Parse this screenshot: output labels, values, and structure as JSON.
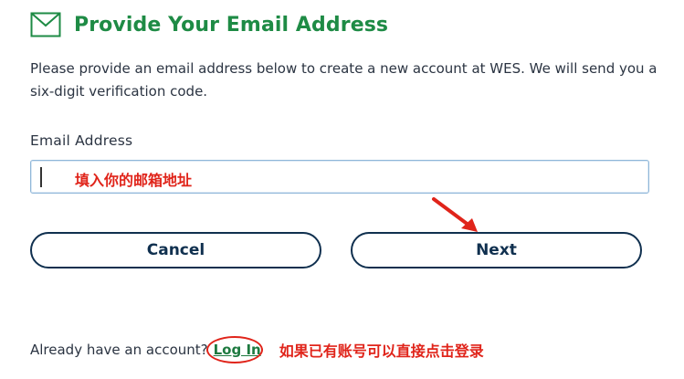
{
  "header": {
    "title": "Provide Your Email Address",
    "icon": "mail-icon"
  },
  "description": "Please provide an email address below to create a new account at WES. We will send you a six-digit verification code.",
  "email": {
    "label": "Email Address",
    "value": "",
    "annotation": "填入你的邮箱地址"
  },
  "buttons": {
    "cancel": "Cancel",
    "next": "Next"
  },
  "footer": {
    "prompt": "Already have an account?",
    "login_link": "Log In",
    "annotation": "如果已有账号可以直接点击登录"
  },
  "colors": {
    "title": "#1e8b45",
    "button_border": "#10304f",
    "annotation": "#e0241a",
    "input_border": "#8fb6d8"
  }
}
